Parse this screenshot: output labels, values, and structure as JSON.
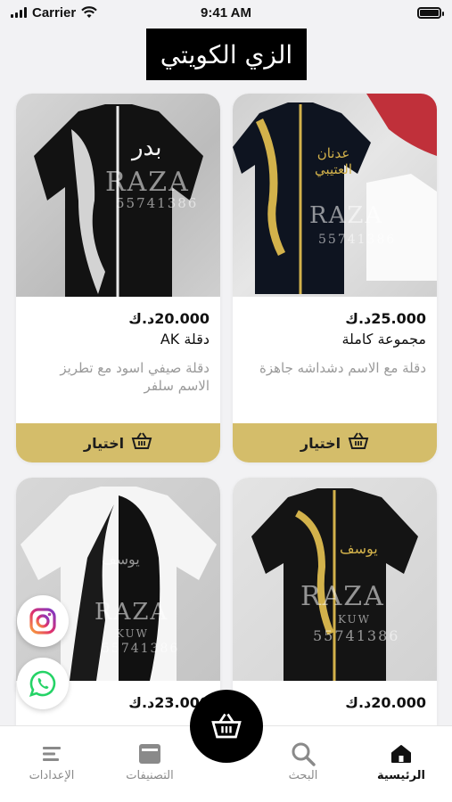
{
  "status_bar": {
    "carrier": "Carrier",
    "time": "9:41 AM"
  },
  "header": {
    "logo_text": "الزي الكويتي"
  },
  "products": [
    {
      "price": "20.000د.ك",
      "name": "دقلة AK",
      "description": "دقلة صيفي اسود مع تطريز الاسم سلفر",
      "button_label": "اختيار",
      "photo_text": "بدر"
    },
    {
      "price": "25.000د.ك",
      "name": "مجموعة كاملة",
      "description": "دقلة مع الاسم دشداشه جاهزة",
      "button_label": "اختيار",
      "photo_text": "عدنان العتيبي"
    },
    {
      "price": "23.000د.ك",
      "name": "",
      "description": "",
      "button_label": "",
      "photo_text": "يوسف"
    },
    {
      "price": "20.000د.ك",
      "name": "",
      "description": "",
      "button_label": "",
      "photo_text": "يوسف"
    }
  ],
  "watermark": {
    "brand": "RAZA",
    "sub": "KUW",
    "phone": "55741386"
  },
  "social": {
    "instagram_icon": "instagram-icon",
    "whatsapp_icon": "whatsapp-icon"
  },
  "tab_bar": {
    "settings": "الإعدادات",
    "categories": "التصنيفات",
    "search": "البحث",
    "home": "الرئيسية"
  },
  "colors": {
    "accent": "#d4bd6a",
    "background": "#f2f2f4"
  }
}
